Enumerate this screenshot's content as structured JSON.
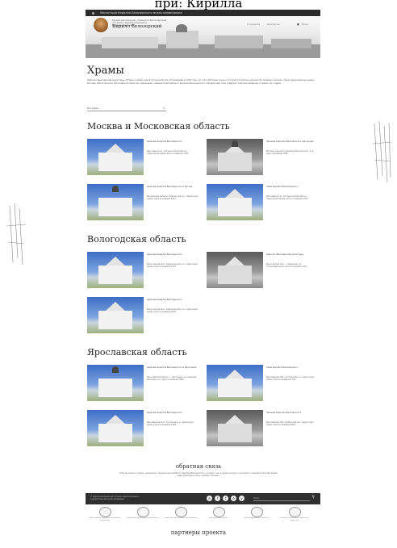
{
  "caption": "при: Кирилла",
  "topbar": {
    "text": "Монастыри Кирилло-Белозерского музея-заповедника"
  },
  "header": {
    "logo_text": "Музей-заповедник «Кирилло-Белозерский историко-архитектурный и художественный»",
    "site_name": "Кирилл Белозерский",
    "nav": [
      "О проекте",
      "Контакты",
      "Вход"
    ]
  },
  "main": {
    "title": "Храмы",
    "intro": "Кирилло-Белозерский монастырь оставил особый след в истории России. Основанный в 1397 году, он стал обителью, вокруг которой сложилось множество храмов и часовен. Ниже представлены храмы Москвы, Вологодской и Ярославской областей, связанные с именем преподобного Кирилла Белозерского. Каждая карточка содержит краткие сведения о храме и его адрес.",
    "filter": {
      "value": "Все храмы",
      "chevron": "▾"
    }
  },
  "regions": [
    {
      "name": "Москва и Московская область",
      "cards": [
        {
          "title": "Церковь Кирилла Белозерского",
          "address": "Ярославское ш., Лосиноостровский р-н, территория храма, дата основания 1705"
        },
        {
          "title": "Часовня Кирилла Белозерского при храме",
          "address": "Москва, переулок Кирилла Белозерского, д. 2, дата основания 1890"
        },
        {
          "title": "Церковь Кирилла Белозерского в Бутове",
          "address": "Московская область, Подольский р-н, территория храма, дата основания 1912"
        },
        {
          "title": "Храм Кирилла Белозерского",
          "address": "Ярославское ш., Лосиноостровский р-н, территория храма, дата основания 1705"
        }
      ]
    },
    {
      "name": "Вологодская область",
      "cards": [
        {
          "title": "Церковь Кирилла Белозерского",
          "address": "Вологодская обл., Кирилловский р-н, территория храма, дата основания 1532"
        },
        {
          "title": "Кирилло-Белозерский монастырь",
          "address": "Вологодская обл., г. Кириллов, ул. Гостинодворская, дата основания 1397"
        },
        {
          "title": "Церковь Кирилла Белозерского",
          "address": "Вологодская обл., Кирилловский р-н, территория храма, дата основания 1645"
        }
      ]
    },
    {
      "name": "Ярославская область",
      "cards": [
        {
          "title": "Церковь Кирилла Белозерского в Ярославле",
          "address": "Ярославская область, г. Ярославль, ул. Кирилла Белозерского, дата основания 1650"
        },
        {
          "title": "Храм Кирилла Белозерского",
          "address": "Ярославская обл., Ростовский р-н, территория храма, дата основания 1702"
        },
        {
          "title": "Церковь Кирилла Белозерского",
          "address": "Ярославская обл., Угличский р-н, территория храма, дата основания 1788"
        },
        {
          "title": "Часовня Кирилла Белозерского",
          "address": "Ярославская обл., Рыбинский р-н, территория храма, дата основания 1820"
        }
      ]
    }
  ],
  "feedback": {
    "title": "обратная связь",
    "text": "Если вы знаете о храме, связанном с именем преподобного Кирилла Белозерского, которого нет в нашем списке, пожалуйста, напишите нам. Мы будем рады дополнить карту храмов и часовен."
  },
  "footer": {
    "text": "© Кирилло-Белозерский историко-архитектурный и художественный музей-заповедник",
    "social": [
      "в",
      "f",
      "t",
      "о",
      "у"
    ],
    "search_placeholder": "Поиск",
    "search_icon": "⚲"
  },
  "partners": {
    "title": "партнеры проекта",
    "items": [
      "Министерство культуры Российской Федерации",
      "Правительство Вологодской области",
      "Кирилловский муниципальный район",
      "Вологодская епархия",
      "Фонд Кирилла Белозерского",
      "Российское военно-историческое общество"
    ]
  },
  "colors": {
    "topbar": "#2b2b2b",
    "footer": "#2f2f2f",
    "sky": "#3e6ec4"
  }
}
